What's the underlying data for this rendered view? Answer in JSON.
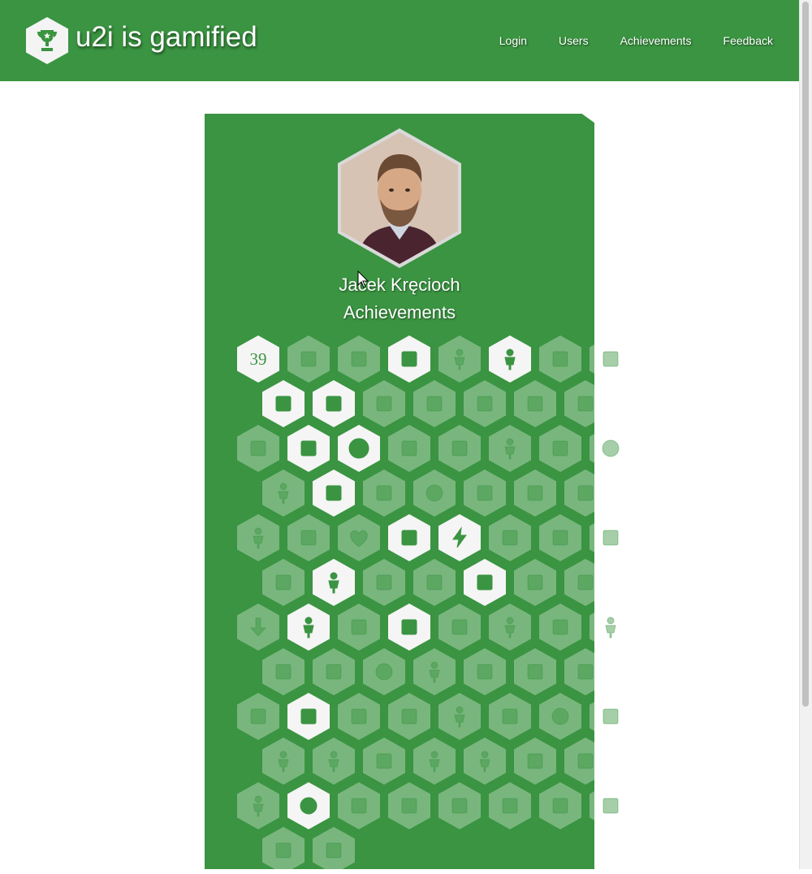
{
  "header": {
    "site_title": "u2i is gamified",
    "nav": [
      "Login",
      "Users",
      "Achievements",
      "Feedback"
    ]
  },
  "profile": {
    "name": "Jacek Kręcioch",
    "section_title": "Achievements"
  },
  "colors": {
    "brand_green": "#3a9441",
    "badge_earned": "#f5f5f5",
    "badge_locked": "rgba(255,255,255,0.32)"
  },
  "achievements": [
    {
      "icon": "number-39-icon",
      "earned": true,
      "text": "39"
    },
    {
      "icon": "stack-icon",
      "earned": false
    },
    {
      "icon": "waves-icon",
      "earned": false
    },
    {
      "icon": "parrot-icon",
      "earned": true
    },
    {
      "icon": "person-cap-icon",
      "earned": false
    },
    {
      "icon": "person-frame-icon",
      "earned": true
    },
    {
      "icon": "microphone-icon",
      "earned": false
    },
    {
      "icon": "document-pencil-icon",
      "earned": false
    },
    {
      "icon": "exit-door-icon",
      "earned": true
    },
    {
      "icon": "cube-grid-icon",
      "earned": true
    },
    {
      "icon": "bug-icon",
      "earned": false
    },
    {
      "icon": "goal-icon",
      "earned": false
    },
    {
      "icon": "ship-wheel-icon",
      "earned": false
    },
    {
      "icon": "seesaw-icon",
      "earned": false
    },
    {
      "icon": "cloud-icon",
      "earned": false
    },
    {
      "icon": "no-entry-icon",
      "earned": false
    },
    {
      "icon": "sofa-icon",
      "earned": true
    },
    {
      "icon": "zero-ring-icon",
      "earned": true
    },
    {
      "icon": "bed-icon",
      "earned": false
    },
    {
      "icon": "stairs-icon",
      "earned": false
    },
    {
      "icon": "reading-person-icon",
      "earned": false
    },
    {
      "icon": "cpr-icon",
      "earned": false
    },
    {
      "icon": "bald-head-icon",
      "earned": false
    },
    {
      "icon": "traveler-icon",
      "earned": false
    },
    {
      "icon": "fire-extinguisher-icon",
      "earned": true
    },
    {
      "icon": "ok-hand-icon",
      "earned": false
    },
    {
      "icon": "head-gears-icon",
      "earned": false
    },
    {
      "icon": "mustache-icon",
      "earned": false
    },
    {
      "icon": "christmas-tree-icon",
      "earned": false
    },
    {
      "icon": "coffee-machine-icon",
      "earned": false
    },
    {
      "icon": "meditation-icon",
      "earned": false
    },
    {
      "icon": "team-icon",
      "earned": false
    },
    {
      "icon": "heart-icon",
      "earned": false
    },
    {
      "icon": "burger-icon",
      "earned": true
    },
    {
      "icon": "party-popper-icon",
      "earned": true
    },
    {
      "icon": "signpost-icon",
      "earned": false
    },
    {
      "icon": "robot-icon",
      "earned": false
    },
    {
      "icon": "cash-icon",
      "earned": false
    },
    {
      "icon": "board-game-icon",
      "earned": false
    },
    {
      "icon": "detective-icon",
      "earned": true
    },
    {
      "icon": "lightbulb-icon",
      "earned": false
    },
    {
      "icon": "sunrise-icon",
      "earned": false
    },
    {
      "icon": "footprint-icon",
      "earned": true
    },
    {
      "icon": "clapping-icon",
      "earned": false
    },
    {
      "icon": "chef-hat-icon",
      "earned": false
    },
    {
      "icon": "arrow-down-icon",
      "earned": false
    },
    {
      "icon": "elf-icon",
      "earned": true
    },
    {
      "icon": "goat-icon",
      "earned": false
    },
    {
      "icon": "ok-gesture-icon",
      "earned": true
    },
    {
      "icon": "coffin-icon",
      "earned": false
    },
    {
      "icon": "figure-icon",
      "earned": false
    },
    {
      "icon": "hand-icon",
      "earned": false
    },
    {
      "icon": "iron-man-icon",
      "earned": false
    },
    {
      "icon": "envelope-icon",
      "earned": false
    },
    {
      "icon": "megaphone-icon",
      "earned": false
    },
    {
      "icon": "idea-head-icon",
      "earned": false
    },
    {
      "icon": "hiker-icon",
      "earned": false
    },
    {
      "icon": "pizza-icon",
      "earned": false
    },
    {
      "icon": "community-icon",
      "earned": false
    },
    {
      "icon": "presentation-icon",
      "earned": false
    },
    {
      "icon": "rubber-duck-icon",
      "earned": false
    },
    {
      "icon": "candle-icon",
      "earned": true
    },
    {
      "icon": "target-icon",
      "earned": false
    },
    {
      "icon": "racetrack-icon",
      "earned": false
    },
    {
      "icon": "runner-icon",
      "earned": false
    },
    {
      "icon": "santa-hat-icon",
      "earned": false
    },
    {
      "icon": "zombie-icon",
      "earned": false
    },
    {
      "icon": "sheep-icon",
      "earned": false
    },
    {
      "icon": "falling-person-icon",
      "earned": false
    },
    {
      "icon": "bookshelf-icon",
      "earned": false
    },
    {
      "icon": "fingers-crossed-icon",
      "earned": false
    },
    {
      "icon": "standing-man-icon",
      "earned": false
    },
    {
      "icon": "gardener-icon",
      "earned": false
    },
    {
      "icon": "checklist-icon",
      "earned": false
    },
    {
      "icon": "first-aid-icon",
      "earned": false
    },
    {
      "icon": "person-door-icon",
      "earned": false
    },
    {
      "icon": "bearded-face-icon",
      "earned": true
    },
    {
      "icon": "menorah-icon",
      "earned": false
    },
    {
      "icon": "splash-icon",
      "earned": false
    },
    {
      "icon": "rock-hand-icon",
      "earned": false
    },
    {
      "icon": "suitcase-icon",
      "earned": false
    },
    {
      "icon": "phone-icon",
      "earned": false
    },
    {
      "icon": "dentist-icon",
      "earned": false
    },
    {
      "icon": "flip-flops-icon",
      "earned": false
    },
    {
      "icon": "money-shovel-icon",
      "earned": false
    }
  ]
}
